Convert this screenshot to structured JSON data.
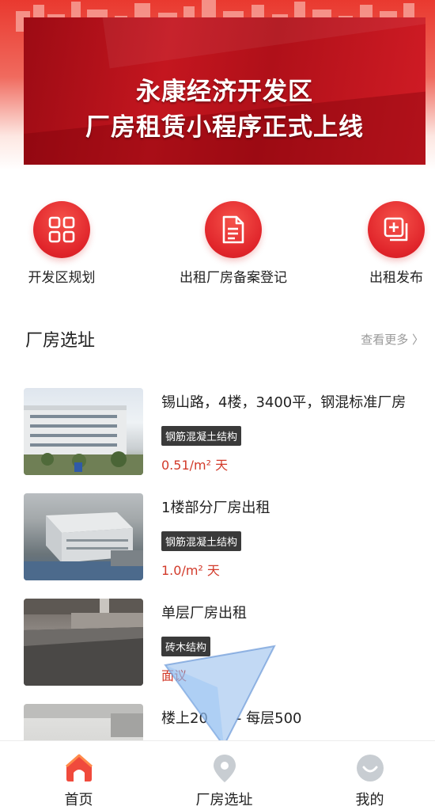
{
  "banner": {
    "line1": "永康经济开发区",
    "line2": "厂房租赁小程序正式上线"
  },
  "features": [
    {
      "label": "开发区规划",
      "icon": "grid-icon"
    },
    {
      "label": "出租厂房备案登记",
      "icon": "document-icon"
    },
    {
      "label": "出租发布",
      "icon": "add-copy-icon"
    }
  ],
  "section": {
    "title": "厂房选址",
    "more": "查看更多 〉"
  },
  "listings": [
    {
      "title": "锡山路，4楼，3400平，钢混标准厂房",
      "tag": "钢筋混凝土结构",
      "price": "0.51/m² 天"
    },
    {
      "title": "1楼部分厂房出租",
      "tag": "钢筋混凝土结构",
      "price": "1.0/m² 天"
    },
    {
      "title": "单层厂房出租",
      "tag": "砖木结构",
      "price": "面议"
    },
    {
      "title": "楼上20　　- 每层500",
      "tag": "",
      "price": ""
    }
  ],
  "tabbar": [
    {
      "label": "首页",
      "icon": "home-icon",
      "active": true
    },
    {
      "label": "厂房选址",
      "icon": "location-pin-icon",
      "active": false
    },
    {
      "label": "我的",
      "icon": "profile-icon",
      "active": false
    }
  ],
  "colors": {
    "accent": "#e0242a",
    "price": "#d23a2a",
    "tag_bg": "#3a3a3a"
  }
}
